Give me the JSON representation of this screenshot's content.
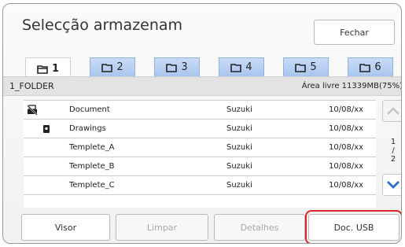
{
  "dialog": {
    "title": "Selecção armazenam",
    "close_label": "Fechar"
  },
  "tabs": [
    {
      "label": "1",
      "active": true
    },
    {
      "label": "2",
      "active": false
    },
    {
      "label": "3",
      "active": false
    },
    {
      "label": "4",
      "active": false
    },
    {
      "label": "5",
      "active": false
    },
    {
      "label": "6",
      "active": false
    }
  ],
  "folder": {
    "name": "1_FOLDER",
    "free_space": "Área livre 11339MB(75%)"
  },
  "files": [
    {
      "name": "Document",
      "owner": "Suzuki",
      "date": "10/08/xx",
      "icon": "no-print-icon"
    },
    {
      "name": "Drawings",
      "owner": "Suzuki",
      "date": "10/08/xx",
      "icon": "lock-icon"
    },
    {
      "name": "Templete_A",
      "owner": "Suzuki",
      "date": "10/08/xx",
      "icon": ""
    },
    {
      "name": "Templete_B",
      "owner": "Suzuki",
      "date": "10/08/xx",
      "icon": ""
    },
    {
      "name": "Templete_C",
      "owner": "Suzuki",
      "date": "10/08/xx",
      "icon": ""
    }
  ],
  "pagination": {
    "current": "1",
    "separator": "/",
    "total": "2"
  },
  "buttons": {
    "visor": "Visor",
    "limpar": "Limpar",
    "detalhes": "Detalhes",
    "doc_usb": "Doc. USB"
  },
  "colors": {
    "tab_inactive": "#b7cff2",
    "scroll_arrow": "#2f6fc4",
    "highlight": "#d9242b"
  }
}
